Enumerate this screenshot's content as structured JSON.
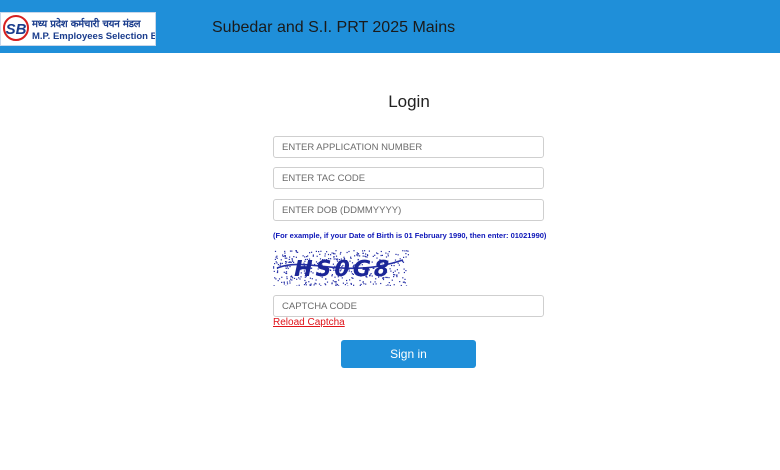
{
  "header": {
    "logo": {
      "mark": "SB",
      "line1": "मध्य प्रदेश कर्मचारी चयन मंडल",
      "line2": "M.P. Employees Selection Board"
    },
    "title": "Subedar and S.I. PRT 2025 Mains"
  },
  "login": {
    "heading": "Login",
    "application_placeholder": "ENTER APPLICATION NUMBER",
    "tac_placeholder": "ENTER TAC CODE",
    "dob_placeholder": "ENTER DOB (DDMMYYYY)",
    "dob_hint": "(For example, if your Date of Birth is 01 February 1990, then enter: 01021990)",
    "captcha_image_text": "HS0G8",
    "captcha_placeholder": "CAPTCHA CODE",
    "reload_captcha_label": "Reload Captcha",
    "sign_in_label": "Sign in"
  },
  "colors": {
    "header_bg": "#1f8fd9",
    "brand_navy": "#1a3c8c",
    "hint_blue": "#0d16b8",
    "reload_red": "#e0141b",
    "button_blue": "#1f8fd9"
  },
  "icons": {
    "logo": "mp-employees-selection-board-logo"
  }
}
